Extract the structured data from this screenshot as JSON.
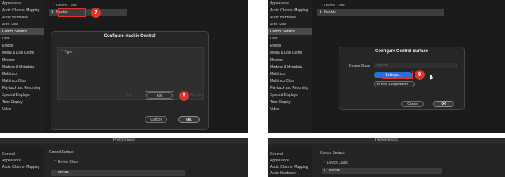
{
  "panels": {
    "top_left": {
      "sidebar": [
        "Appearance",
        "Audio Channel Mapping",
        "Audio Hardware",
        "Auto Save",
        "Control Surface",
        "Data",
        "Effects",
        "Media & Disk Cache",
        "Memory",
        "Markers & Metadata",
        "Multitrack",
        "Multitrack Clips",
        "Playback and Recording",
        "Spectral Displays",
        "Time Display",
        "Video"
      ],
      "selected": "Control Surface",
      "table_header": "Device Class",
      "table_row_index": "1",
      "table_row_value": "Mackie",
      "step_a": "7",
      "dialog": {
        "title": "Configure Mackie Control",
        "list_header": "Type",
        "edit_label": "Edit",
        "add_label": "Add",
        "remove_label": "Remove",
        "cancel_label": "Cancel",
        "ok_label": "OK"
      },
      "step_b": "8"
    },
    "top_right": {
      "sidebar": [
        "Appearance",
        "Audio Channel Mapping",
        "Audio Hardware",
        "Auto Save",
        "Control Surface",
        "Data",
        "Effects",
        "Media & Disk Cache",
        "Memory",
        "Markers & Metadata",
        "Multitrack",
        "Multitrack Clips",
        "Playback and Recording",
        "Spectral Displays",
        "Time Display",
        "Video"
      ],
      "selected": "Control Surface",
      "table_header": "Device Class",
      "table_row_index": "1",
      "table_row_value": "Mackie",
      "dialog": {
        "title": "Configure Control Surface",
        "device_class_label": "Device Class",
        "device_class_value": "Mackie",
        "settings_label": "Settings...",
        "assign_label": "Button Assignments...",
        "cancel_label": "Cancel",
        "ok_label": "OK"
      },
      "step": "9"
    },
    "bottom_left": {
      "window_title": "Preferences",
      "sidebar": [
        "General",
        "Appearance",
        "Audio Channel Mapping"
      ],
      "section_title": "Control Surface",
      "table_header": "Device Class",
      "table_row_index": "1",
      "table_row_value": "Mackie"
    },
    "bottom_right": {
      "window_title": "Preferences",
      "sidebar": [
        "General",
        "Appearance",
        "Audio Channel Mapping",
        "Audio Hardware"
      ],
      "section_title": "Control Surface",
      "table_header": "Device Class",
      "table_row_index": "1",
      "table_row_value": "Mackie"
    }
  },
  "colors": {
    "callout": "#e0332b",
    "primary_button": "#2d6cdf",
    "panel_background": "#1b1b1b"
  }
}
